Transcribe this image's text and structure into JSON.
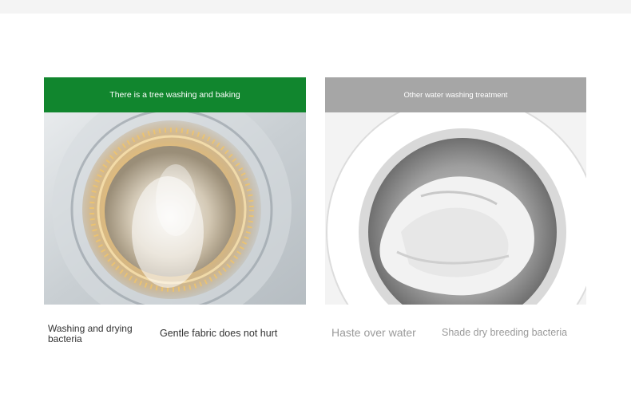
{
  "left_panel": {
    "header": "There is a tree washing and baking",
    "header_color": "#11862e",
    "image": "washing-machine-drum-with-warm-heating-light",
    "captions": [
      "Washing and drying bacteria",
      "Gentle fabric does not hurt"
    ]
  },
  "right_panel": {
    "header": "Other water washing treatment",
    "header_color": "#a6a6a6",
    "image": "washing-machine-drum-with-white-laundry",
    "captions": [
      "Haste over water",
      "Shade dry breeding bacteria"
    ]
  }
}
